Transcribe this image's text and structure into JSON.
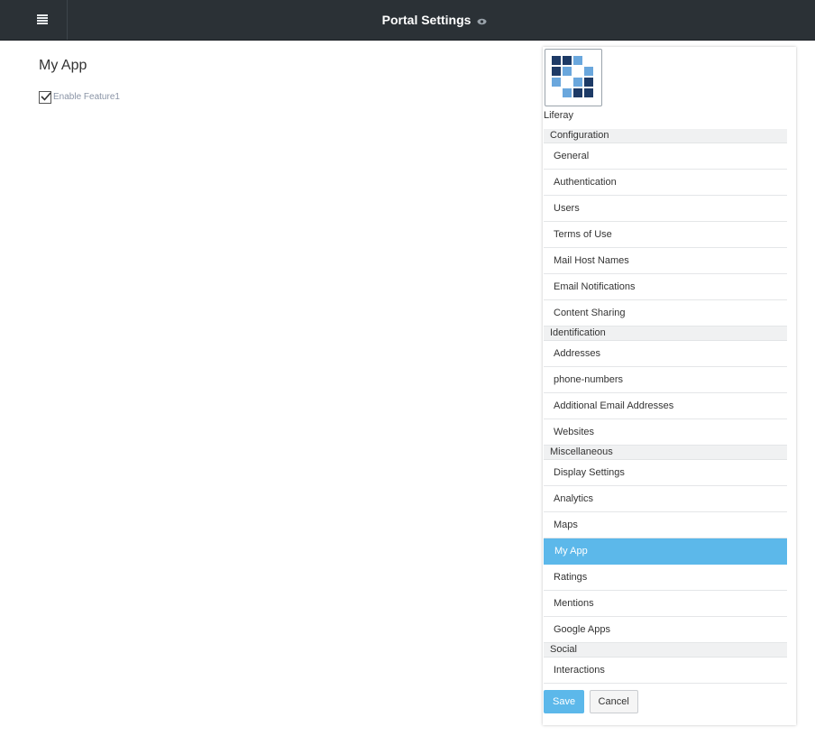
{
  "topbar": {
    "title": "Portal Settings",
    "menu_icon": "hamburger-icon",
    "preview_icon": "eye-icon"
  },
  "main": {
    "app_title": "My App",
    "feature_label": "Enable Feature1",
    "feature_checked": true
  },
  "panel": {
    "company_name": "Liferay",
    "sections": [
      {
        "name": "Configuration",
        "items": [
          "General",
          "Authentication",
          "Users",
          "Terms of Use",
          "Mail Host Names",
          "Email Notifications",
          "Content Sharing"
        ]
      },
      {
        "name": "Identification",
        "items": [
          "Addresses",
          "phone-numbers",
          "Additional Email Addresses",
          "Websites"
        ]
      },
      {
        "name": "Miscellaneous",
        "items": [
          "Display Settings",
          "Analytics",
          "Maps",
          "My App",
          "Ratings",
          "Mentions",
          "Google Apps"
        ]
      },
      {
        "name": "Social",
        "items": [
          "Interactions"
        ]
      }
    ],
    "active_item": "My App",
    "save_label": "Save",
    "cancel_label": "Cancel"
  },
  "colors": {
    "topbar": "#2b3136",
    "accent": "#5cb8ea",
    "logo_dark": "#1d3a66",
    "logo_light": "#6aa7dd"
  }
}
